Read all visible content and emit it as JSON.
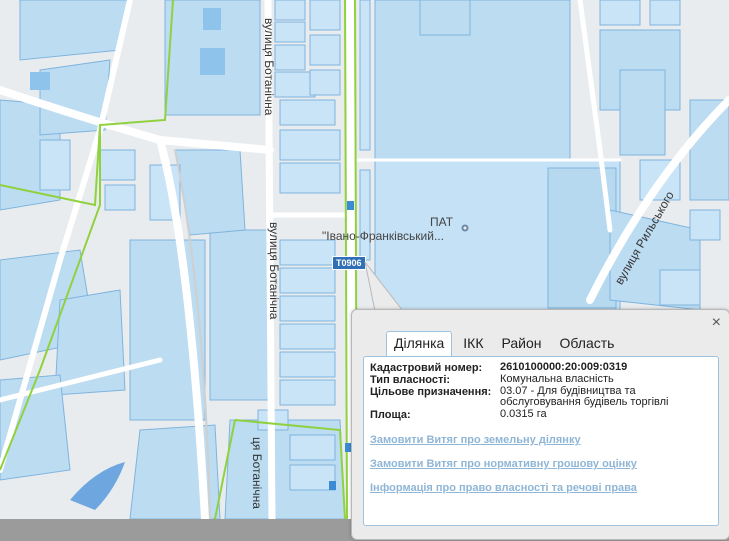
{
  "map": {
    "streets": {
      "botanichna_1": "вулиця Ботанічна",
      "botanichna_2": "вулиця Ботанічна",
      "botanichna_3": "ця Ботанічна",
      "rylskoho": "вулиця Рильського"
    },
    "poi": {
      "line1": "ПАТ",
      "line2": "\"Івано-Франківський..."
    },
    "road_shield": "T0906",
    "colors": {
      "background": "#e9ecef",
      "parcel_fill": "#bcdcf2",
      "parcel_stroke": "#7fb4dd",
      "boundary": "#8fd13f",
      "road": "#ffffff"
    }
  },
  "popup": {
    "close_icon": "×",
    "tabs": [
      "Ділянка",
      "ІКК",
      "Район",
      "Область"
    ],
    "active_tab": "Ділянка",
    "fields": [
      {
        "label": "Кадастровий номер:",
        "value": "2610100000:20:009:0319"
      },
      {
        "label": "Тип власності:",
        "value": "Комунальна власність"
      },
      {
        "label": "Цільове призначення:",
        "value": "03.07 - Для будівництва та обслуговування будівель торгівлі"
      },
      {
        "label": "Площа:",
        "value": "0.0315 га"
      }
    ],
    "links": [
      "Замовити Витяг про земельну ділянку",
      "Замовити Витяг про нормативну грошову оцінку",
      "Інформація про право власності та речові права"
    ]
  }
}
